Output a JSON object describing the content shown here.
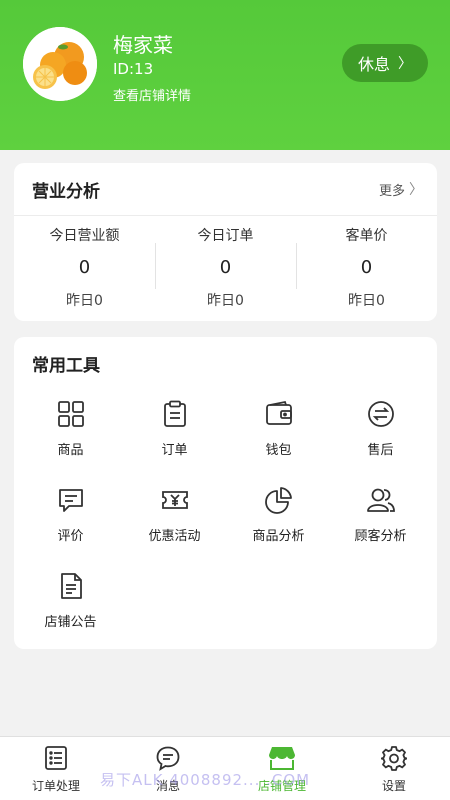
{
  "header": {
    "shop_name": "梅家菜",
    "shop_id": "ID:13",
    "detail_link": "查看店铺详情",
    "rest_button": "休息",
    "rest_chevron": "〉",
    "brand_color": "#5fd13f"
  },
  "business": {
    "title": "营业分析",
    "more": "更多",
    "more_chevron": "〉",
    "stats": [
      {
        "label": "今日营业额",
        "value": "0",
        "yesterday": "昨日0"
      },
      {
        "label": "今日订单",
        "value": "0",
        "yesterday": "昨日0"
      },
      {
        "label": "客单价",
        "value": "0",
        "yesterday": "昨日0"
      }
    ]
  },
  "tools": {
    "title": "常用工具",
    "items": [
      {
        "label": "商品",
        "icon": "grid-icon"
      },
      {
        "label": "订单",
        "icon": "clipboard-icon"
      },
      {
        "label": "钱包",
        "icon": "wallet-icon"
      },
      {
        "label": "售后",
        "icon": "exchange-icon"
      },
      {
        "label": "评价",
        "icon": "comment-icon"
      },
      {
        "label": "优惠活动",
        "icon": "coupon-icon"
      },
      {
        "label": "商品分析",
        "icon": "pie-chart-icon"
      },
      {
        "label": "顾客分析",
        "icon": "users-icon"
      },
      {
        "label": "店铺公告",
        "icon": "document-icon"
      }
    ]
  },
  "tabbar": {
    "items": [
      {
        "label": "订单处理",
        "icon": "list-icon"
      },
      {
        "label": "消息",
        "icon": "message-icon"
      },
      {
        "label": "店铺管理",
        "icon": "store-icon",
        "active": true
      },
      {
        "label": "设置",
        "icon": "gear-icon"
      }
    ],
    "active_color": "#4cb733"
  },
  "watermark": "易下ALK  4008892... .COM"
}
